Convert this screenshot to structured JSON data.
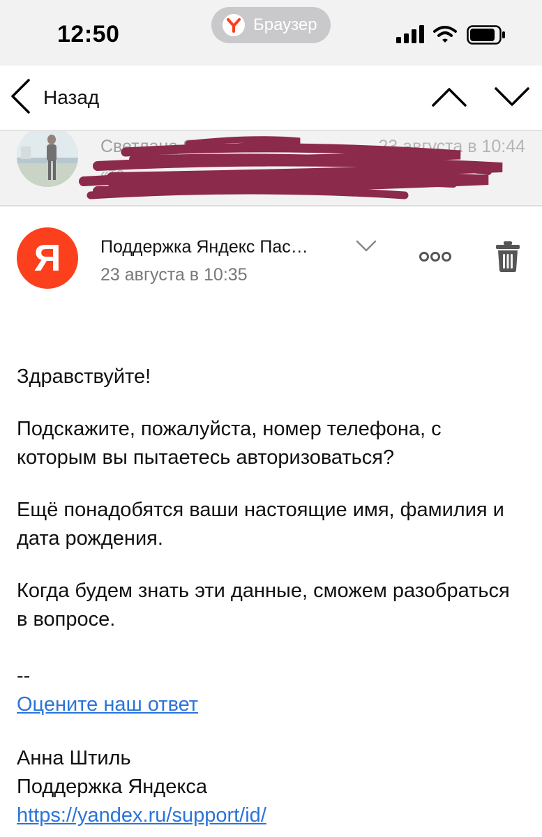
{
  "status_bar": {
    "time": "12:50",
    "browser_label": "Браузер",
    "icons": [
      "signal-icon",
      "wifi-icon",
      "battery-icon"
    ]
  },
  "nav": {
    "back_label": "Назад",
    "icons": [
      "chevron-left-icon",
      "chevron-up-icon",
      "chevron-down-icon"
    ]
  },
  "previous_message": {
    "sender": "Светлана Я",
    "date": "23 августа в 10:44",
    "snippet": "«то...",
    "redacted": true
  },
  "message": {
    "sender_initial": "Я",
    "sender_name": "Поддержка Яндекс Пас…",
    "date": "23 августа в 10:35",
    "body": {
      "greeting": "Здравствуйте!",
      "paragraphs": [
        "Подскажите, пожалуйста, номер телефона, с которым вы пытаетесь авторизоваться?",
        "Ещё понадобятся ваши настоящие имя, фамилия и дата рождения.",
        "Когда будем знать эти данные, сможем разобраться в вопросе."
      ],
      "separator": "--",
      "rate_link": "Оцените наш ответ",
      "signature_name": "Анна Штиль",
      "signature_org": "Поддержка Яндекса",
      "support_url": "https://yandex.ru/support/id/"
    }
  },
  "colors": {
    "yandex_red": "#fc3f1d",
    "link_blue": "#2a74d9",
    "redaction": "#8b2a4a",
    "status_bg": "#f2f2f2"
  }
}
